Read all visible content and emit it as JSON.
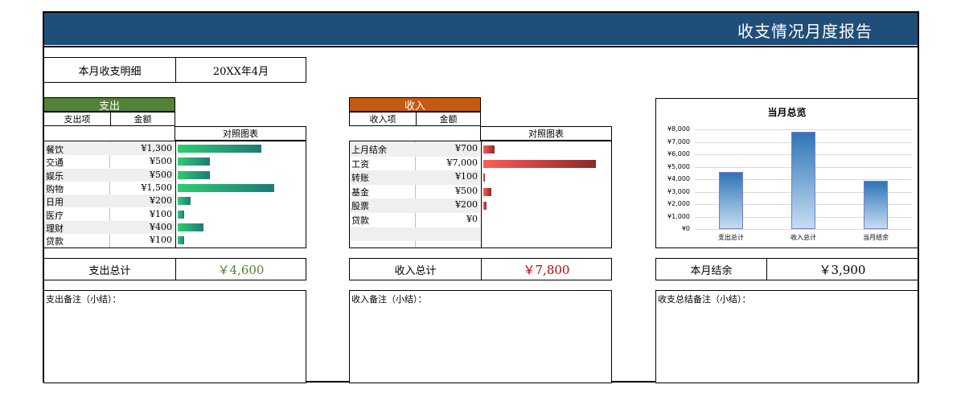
{
  "title": "收支情况月度报告",
  "month_detail": {
    "label": "本月收支明细",
    "value": "20XX年4月"
  },
  "expense": {
    "header": "支出",
    "col_item": "支出项",
    "col_amount": "金额",
    "col_chart": "对照图表",
    "items": [
      {
        "name": "餐饮",
        "amount": "¥1,300",
        "value": 1300
      },
      {
        "name": "交通",
        "amount": "¥500",
        "value": 500
      },
      {
        "name": "娱乐",
        "amount": "¥500",
        "value": 500
      },
      {
        "name": "购物",
        "amount": "¥1,500",
        "value": 1500
      },
      {
        "name": "日用",
        "amount": "¥200",
        "value": 200
      },
      {
        "name": "医疗",
        "amount": "¥100",
        "value": 100
      },
      {
        "name": "理财",
        "amount": "¥400",
        "value": 400
      },
      {
        "name": "贷款",
        "amount": "¥100",
        "value": 100
      }
    ],
    "total_label": "支出总计",
    "total_value": "￥4,600",
    "total_color": "#548235",
    "note_label": "支出备注（小结）："
  },
  "income": {
    "header": "收入",
    "col_item": "收入项",
    "col_amount": "金额",
    "col_chart": "对照图表",
    "items": [
      {
        "name": "上月结余",
        "amount": "¥700",
        "value": 700
      },
      {
        "name": "工资",
        "amount": "¥7,000",
        "value": 7000
      },
      {
        "name": "转账",
        "amount": "¥100",
        "value": 100
      },
      {
        "name": "基金",
        "amount": "¥500",
        "value": 500
      },
      {
        "name": "股票",
        "amount": "¥200",
        "value": 200
      },
      {
        "name": "贷款",
        "amount": "¥0",
        "value": 0
      }
    ],
    "total_label": "收入总计",
    "total_value": "￥7,800",
    "total_color": "#c00000",
    "note_label": "收入备注（小结）："
  },
  "balance": {
    "label": "本月结余",
    "value": "￥3,900",
    "note_label": "收支总结备注（小结）："
  },
  "chart_data": {
    "type": "bar",
    "title": "当月总览",
    "categories": [
      "支出总计",
      "收入总计",
      "当月结余"
    ],
    "values": [
      4600,
      7800,
      3900
    ],
    "ylim": [
      0,
      8000
    ],
    "yticks": [
      "¥0",
      "¥1,000",
      "¥2,000",
      "¥3,000",
      "¥4,000",
      "¥5,000",
      "¥6,000",
      "¥7,000",
      "¥8,000"
    ],
    "grid": true,
    "bar_color": "#2e75b6"
  }
}
